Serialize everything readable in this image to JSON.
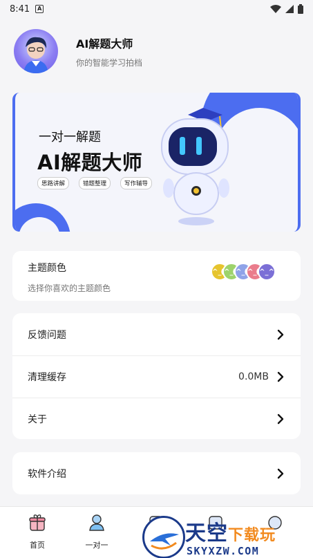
{
  "status_bar": {
    "time": "8:41",
    "indicator": "A"
  },
  "profile": {
    "app_name": "AI解题大师",
    "subtitle": "你的智能学习拍档"
  },
  "banner": {
    "small_title": "一对一解题",
    "big_title": "AI解题大师",
    "tags": [
      "思路讲解",
      "错题整理",
      "写作辅导"
    ],
    "accent_color": "#4c6df0"
  },
  "theme": {
    "title": "主题颜色",
    "subtitle": "选择你喜欢的主题颜色",
    "colors": [
      "#e6c42e",
      "#9dd36b",
      "#8fa3e8",
      "#ea7c8c",
      "#7b6fd6"
    ],
    "swatch_glyph": "(^_^)"
  },
  "settings": {
    "feedback": "反馈问题",
    "clear_cache": "清理缓存",
    "cache_size": "0.0MB",
    "about": "关于",
    "intro": "软件介绍"
  },
  "nav": {
    "home": "首页",
    "one_on_one": "一对一"
  },
  "watermark": {
    "name_a": "天空",
    "name_b": "下载玩",
    "url": "SKYXZW.COM"
  }
}
